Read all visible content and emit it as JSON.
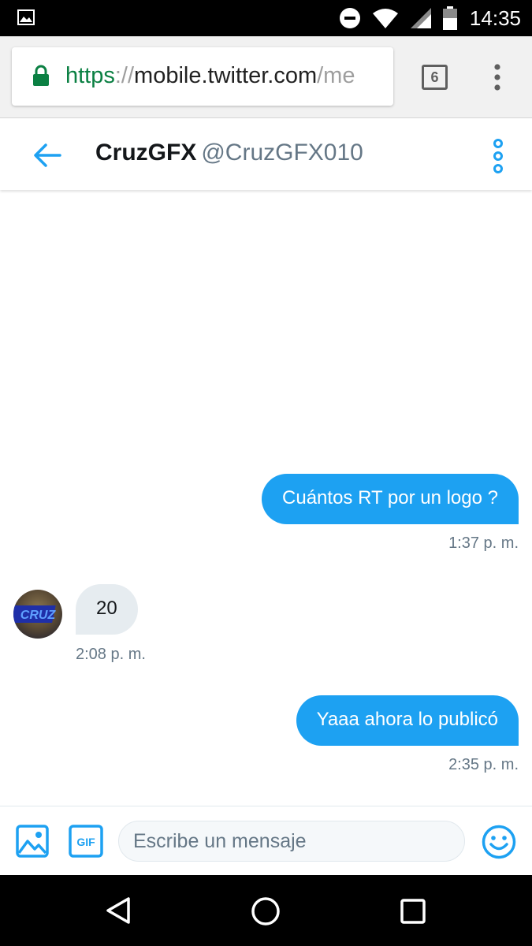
{
  "status_bar": {
    "time": "14:35",
    "icons": [
      "image-notification-icon",
      "do-not-disturb-icon",
      "wifi-icon",
      "cell-signal-icon",
      "battery-icon"
    ]
  },
  "browser": {
    "url_scheme": "https",
    "url_separator": "://",
    "url_host": "mobile.twitter.com",
    "url_path": "/me",
    "tab_count": "6",
    "secure_color": "#0b8043"
  },
  "conversation": {
    "display_name": "CruzGFX",
    "handle": "@CruzGFX010",
    "accent_color": "#1da1f2"
  },
  "messages": [
    {
      "direction": "sent",
      "text": "Cuántos RT por un logo ?",
      "time": "1:37 p. m."
    },
    {
      "direction": "received",
      "text": "20",
      "time": "2:08 p. m."
    },
    {
      "direction": "sent",
      "text": "Yaaa ahora lo publicó",
      "time": "2:35 p. m."
    }
  ],
  "avatar": {
    "logo_text": "CRUZ"
  },
  "composer": {
    "placeholder": "Escribe un mensaje",
    "gif_label": "GIF"
  },
  "nav_bar": {
    "icons": [
      "back-triangle-icon",
      "home-circle-icon",
      "recents-square-icon"
    ]
  }
}
